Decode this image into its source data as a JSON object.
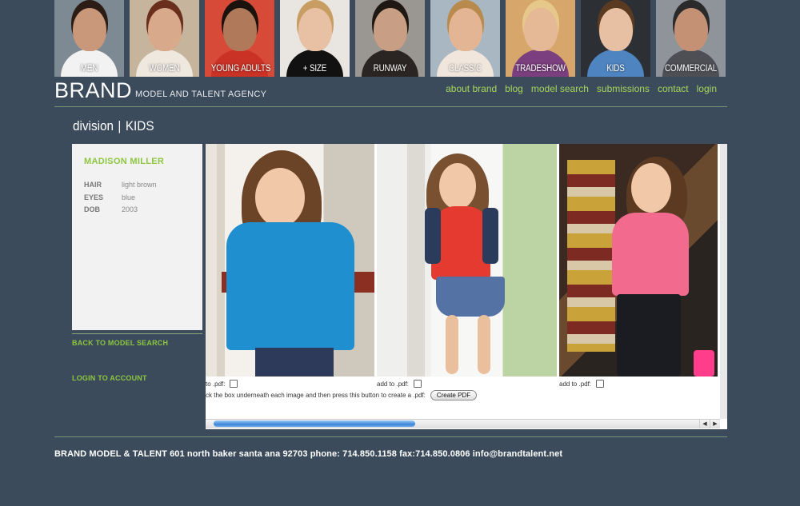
{
  "divisions": [
    {
      "label": "MEN",
      "bg": "#7d8a93",
      "skin": "#c99779",
      "hair": "#2b1d15",
      "shirt": "#f2f2f2"
    },
    {
      "label": "WOMEN",
      "bg": "#c6b59c",
      "skin": "#d8a98a",
      "hair": "#6a2e1d",
      "shirt": "#efe8df"
    },
    {
      "label": "YOUNG ADULTS",
      "bg": "#d84a38",
      "skin": "#b07a5a",
      "hair": "#1c120d",
      "shirt": "#c93225"
    },
    {
      "label": "+ SIZE",
      "bg": "#e9e6e2",
      "skin": "#e8c0a4",
      "hair": "#c79d62",
      "shirt": "#111111"
    },
    {
      "label": "RUNWAY",
      "bg": "#9a9691",
      "skin": "#c89f84",
      "hair": "#1e1712",
      "shirt": "#2a2522"
    },
    {
      "label": "CLASSIC",
      "bg": "#a9b7c2",
      "skin": "#e4b594",
      "hair": "#b98a4e",
      "shirt": "#f1e6dc"
    },
    {
      "label": "TRADESHOW",
      "bg": "#d7a66b",
      "skin": "#e5b896",
      "hair": "#e6c88a",
      "shirt": "#7b3e7e"
    },
    {
      "label": "KIDS",
      "bg": "#2c2f33",
      "skin": "#e7c0a3",
      "hair": "#5b3a22",
      "shirt": "#4e84c0"
    },
    {
      "label": "COMMERCIAL",
      "bg": "#8e949a",
      "skin": "#c49175",
      "hair": "#2a2a2a",
      "shirt": "#4d4f55"
    }
  ],
  "brand": {
    "name": "BRAND",
    "tagline": "MODEL AND TALENT AGENCY"
  },
  "nav": [
    {
      "label": "about brand"
    },
    {
      "label": "blog"
    },
    {
      "label": "model search"
    },
    {
      "label": "submissions"
    },
    {
      "label": "contact"
    },
    {
      "label": "login"
    }
  ],
  "division": {
    "prefix": "division",
    "separator": "|",
    "name": "KIDS"
  },
  "model": {
    "name": "MADISON MILLER",
    "attributes": [
      {
        "key": "HAIR",
        "value": "light brown"
      },
      {
        "key": "EYES",
        "value": "blue"
      },
      {
        "key": "DOB",
        "value": "2003"
      }
    ]
  },
  "sidebar": {
    "back_label": "BACK TO MODEL SEARCH",
    "login_label": "LOGIN TO ACCOUNT"
  },
  "gallery": {
    "pdf_label_first": "to .pdf:",
    "pdf_label": "add to .pdf:",
    "help_text": "ck the box underneath each image and then press this button to create a .pdf:",
    "button_label": "Create PDF"
  },
  "colors": {
    "background": "#3b4b5b",
    "accent": "#8cc63f"
  },
  "footer": {
    "text": "BRAND MODEL & TALENT 601 north baker santa ana 92703 phone: 714.850.1158 fax:714.850.0806 info@brandtalent.net"
  }
}
